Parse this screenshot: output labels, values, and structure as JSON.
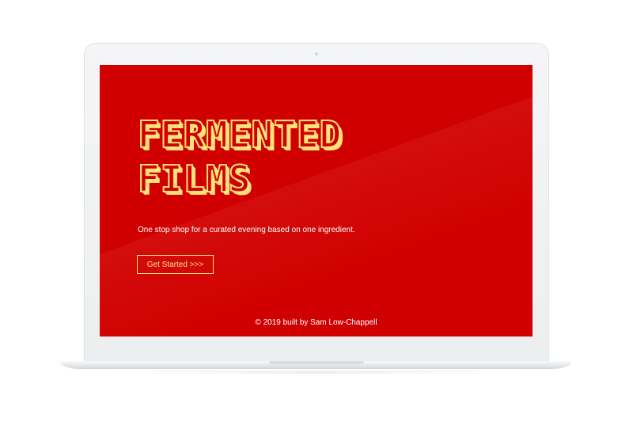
{
  "hero": {
    "title_line1": "FERMENTED",
    "title_line2": "FILMS",
    "tagline": "One stop shop for a curated evening based on one ingredient.",
    "cta_label": "Get Started >>>"
  },
  "footer": {
    "credit": "© 2019 built by Sam Low-Chappell"
  },
  "colors": {
    "background": "#d10000",
    "accent": "#ffe27a",
    "text": "#ffffff"
  }
}
